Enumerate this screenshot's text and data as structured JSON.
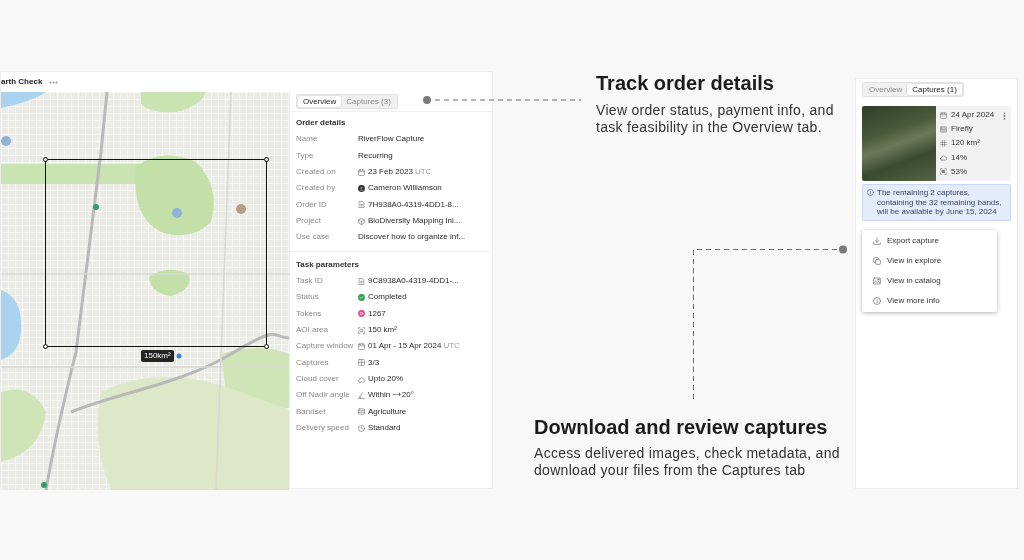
{
  "app": {
    "title": "arth Check"
  },
  "map": {
    "area_label": "150km²"
  },
  "order_panel": {
    "tabs": [
      {
        "label": "Overview",
        "selected": true
      },
      {
        "label": "Captures (3)",
        "selected": false
      }
    ],
    "sections": [
      {
        "title": "Order details",
        "rows": [
          {
            "label": "Name",
            "kind": "text",
            "value": "RiverFlow Capture"
          },
          {
            "label": "Type",
            "kind": "text",
            "value": "Recurring"
          },
          {
            "label": "Created on",
            "kind": "date",
            "value": "23 Feb 2023",
            "suffix": "UTC"
          },
          {
            "label": "Created by",
            "kind": "person",
            "value": "Cameron Williamson"
          },
          {
            "label": "Order ID",
            "kind": "id",
            "value": "7H938A0-4319-4DD1-8..."
          },
          {
            "label": "Project",
            "kind": "project",
            "value": "BioDiversity Mapping Ini..."
          },
          {
            "label": "Use case",
            "kind": "text",
            "value": "Discover how to organize inf..."
          }
        ]
      },
      {
        "title": "Task parameters",
        "rows": [
          {
            "label": "Task ID",
            "kind": "id",
            "value": "9C8938A0-4319-4DD1-..."
          },
          {
            "label": "Status",
            "kind": "status",
            "value": "Completed"
          },
          {
            "label": "Tokens",
            "kind": "tokens",
            "value": "1267"
          },
          {
            "label": "AOI area",
            "kind": "area",
            "value": "150 km²"
          },
          {
            "label": "Capture window",
            "kind": "date",
            "value": "01 Apr - 15 Apr 2024",
            "suffix": "UTC"
          },
          {
            "label": "Captures",
            "kind": "captures",
            "value": "3/3"
          },
          {
            "label": "Cloud cover",
            "kind": "cloud",
            "value": "Upto 20%"
          },
          {
            "label": "Off Nadir angle",
            "kind": "angle",
            "value": "Within ~+20°"
          },
          {
            "label": "Bandset",
            "kind": "bandset",
            "value": "Agriculture"
          },
          {
            "label": "Delivery speed",
            "kind": "speed",
            "value": "Standard"
          }
        ]
      }
    ]
  },
  "callouts": [
    {
      "title": "Track order details",
      "text": "View order status, payment info, and task feasibility in the Overview tab."
    },
    {
      "title": "Download and review captures",
      "text": "Access delivered images, check metadata, and download your files from the Captures tab"
    }
  ],
  "captures_panel": {
    "tabs": [
      {
        "label": "Overview",
        "selected": false
      },
      {
        "label": "Captures (1)",
        "selected": true
      }
    ],
    "capture": {
      "details": [
        {
          "kind": "date",
          "text": "24 Apr 2024"
        },
        {
          "kind": "satellite",
          "text": "Firefly"
        },
        {
          "kind": "area",
          "text": "120 km²"
        },
        {
          "kind": "cloud",
          "text": "14%"
        },
        {
          "kind": "coverage",
          "text": "53%"
        }
      ]
    },
    "notice": "The remaining 2 captures, containing the 32 remaining bands, will be available by June 15, 2024",
    "menu": [
      {
        "kind": "export",
        "label": "Export capture"
      },
      {
        "kind": "explore",
        "label": "View in explore"
      },
      {
        "kind": "catalog",
        "label": "View in catalog"
      },
      {
        "kind": "info",
        "label": "View more info"
      }
    ]
  }
}
